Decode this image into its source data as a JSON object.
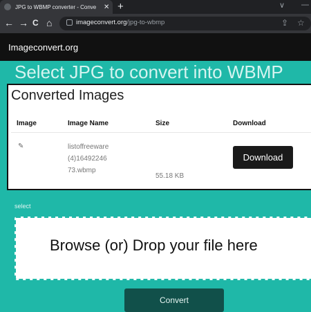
{
  "browser": {
    "tab_title": "JPG to WBMP converter - Conve",
    "tab_close": "✕",
    "new_tab": "+",
    "minimize": "—",
    "chevron": "∨",
    "url_domain": "imageconvert.org",
    "url_path": "/jpg-to-wbmp",
    "back": "←",
    "forward": "→",
    "reload": "C",
    "home": "⌂",
    "share": "⇪",
    "star": "☆"
  },
  "site": {
    "logo": "Imageconvert.org"
  },
  "page": {
    "heading": "Select JPG to convert into WBMP",
    "panel_title": "Converted Images",
    "columns": [
      "Image",
      "Image Name",
      "Size",
      "Download"
    ],
    "file": {
      "thumb_alt": "✎",
      "name_lines": [
        "listoffreeware",
        "(4)16492246",
        "73.wbmp"
      ],
      "size": "55.18 KB",
      "download_label": "Download"
    },
    "select_label": "select",
    "drop_text": "Browse (or) Drop your file here",
    "convert_label": "Convert"
  },
  "colors": {
    "teal": "#1fb8a8",
    "dark": "#111111",
    "convert_bg": "#11504a"
  }
}
